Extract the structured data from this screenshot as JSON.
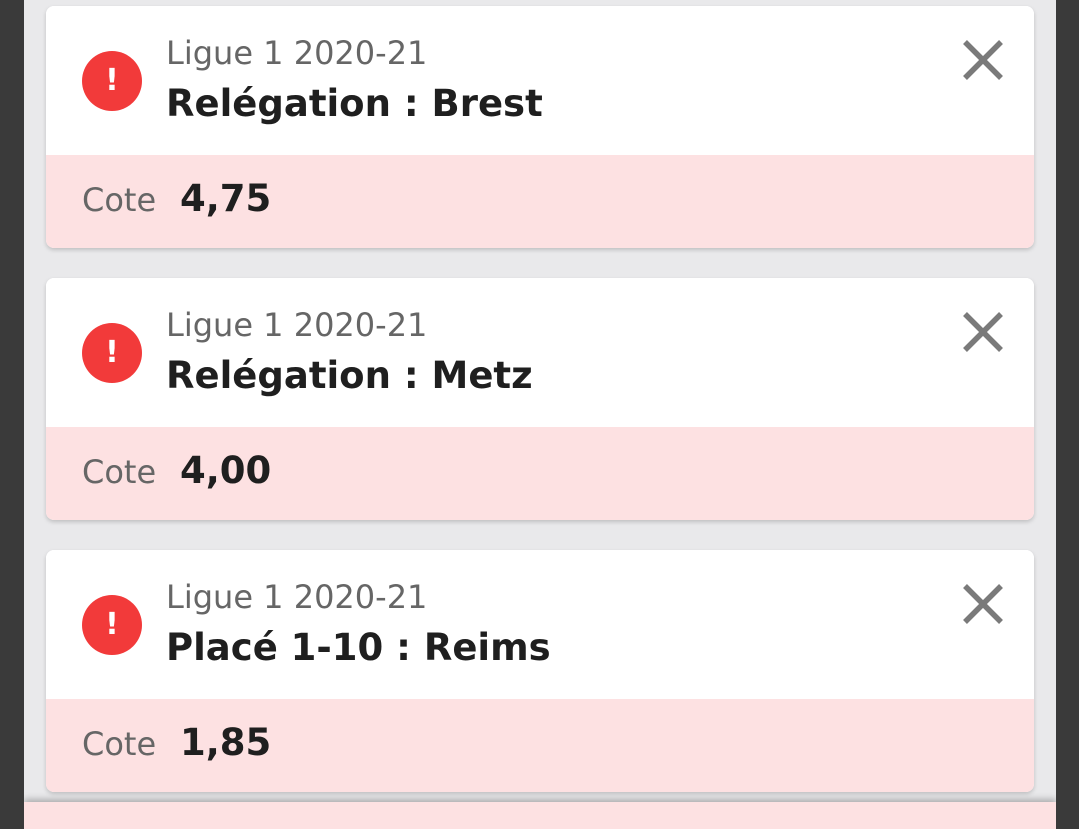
{
  "colors": {
    "alert": "#f23a3a",
    "odds_background": "#fde1e2",
    "panel_background": "#e9e9eb"
  },
  "bets": [
    {
      "league": "Ligue 1 2020-21",
      "market": "Relégation : Brest",
      "odds_label": "Cote",
      "odds_value": "4,75",
      "status_icon": "alert-icon",
      "alert_glyph": "!"
    },
    {
      "league": "Ligue 1 2020-21",
      "market": "Relégation : Metz",
      "odds_label": "Cote",
      "odds_value": "4,00",
      "status_icon": "alert-icon",
      "alert_glyph": "!"
    },
    {
      "league": "Ligue 1 2020-21",
      "market": "Placé 1-10 : Reims",
      "odds_label": "Cote",
      "odds_value": "1,85",
      "status_icon": "alert-icon",
      "alert_glyph": "!"
    }
  ]
}
